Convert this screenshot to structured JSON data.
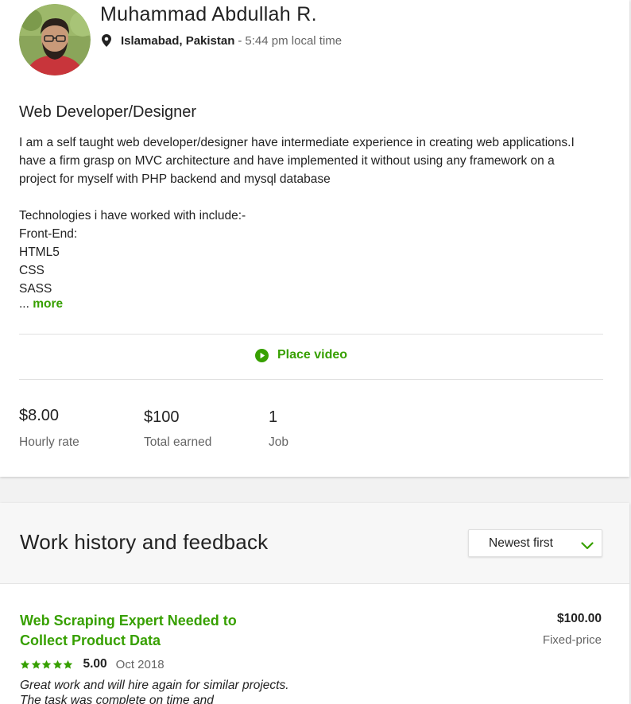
{
  "profile": {
    "name": "Muhammad Abdullah R.",
    "city": "Islamabad, Pakistan",
    "separator": "-",
    "local_time": "5:44 pm local time",
    "title": "Web Developer/Designer",
    "overview": "I am a self taught web developer/designer have intermediate experience in creating web applications.I have a firm grasp on MVC architecture and have implemented it without using any framework on a project for myself with PHP backend and mysql database\n\nTechnologies i have worked with include:-\nFront-End:\nHTML5\nCSS\nSASS",
    "ellipsis": "...",
    "more_label": "more",
    "place_video_label": "Place video"
  },
  "stats": [
    {
      "value": "$8.00",
      "label": "Hourly rate"
    },
    {
      "value": "$100",
      "label": "Total earned"
    },
    {
      "value": "1",
      "label": "Job"
    }
  ],
  "work_history": {
    "title": "Work history and feedback",
    "sort_selected": "Newest first",
    "jobs": [
      {
        "title": "Web Scraping Expert Needed to Collect Product Data",
        "amount": "$100.00",
        "type": "Fixed-price",
        "rating": "5.00",
        "stars": 5,
        "date": "Oct 2018",
        "feedback": "Great work and will hire again for similar projects. The task was complete on time and"
      }
    ]
  },
  "colors": {
    "accent_green": "#37a000",
    "text_dark": "#222222",
    "text_muted": "#656565"
  },
  "icons": {
    "location": "map-pin-icon",
    "place_video": "play-circle-icon",
    "sort": "chevron-down-icon",
    "rating": "star-icon"
  }
}
